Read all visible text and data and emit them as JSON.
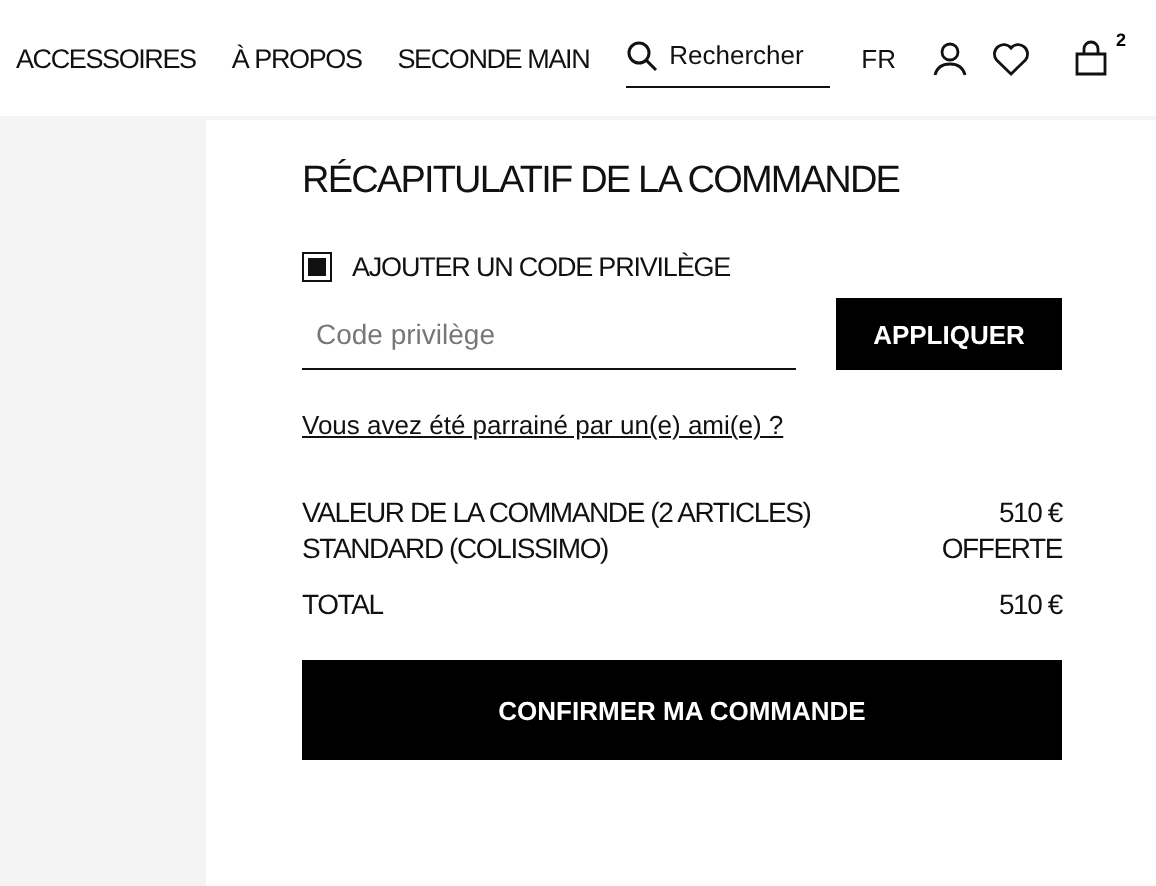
{
  "nav": {
    "links": [
      "ACCESSOIRES",
      "À PROPOS",
      "SECONDE MAIN"
    ],
    "search": {
      "placeholder": "Rechercher"
    },
    "language": "FR",
    "cart_count": "2"
  },
  "summary": {
    "title": "RÉCAPITULATIF DE LA COMMANDE",
    "promo": {
      "label": "AJOUTER UN CODE PRIVILÈGE",
      "checked": true,
      "placeholder": "Code privilège",
      "button": "APPLIQUER"
    },
    "referral_link": "Vous avez été parrainé par un(e) ami(e) ?",
    "lines": [
      {
        "label": "VALEUR DE LA COMMANDE (2 ARTICLES)",
        "value": "510 €"
      },
      {
        "label": "STANDARD (COLISSIMO)",
        "value": "OFFERTE"
      }
    ],
    "total": {
      "label": "TOTAL",
      "value": "510 €"
    },
    "confirm": "CONFIRMER MA COMMANDE"
  }
}
